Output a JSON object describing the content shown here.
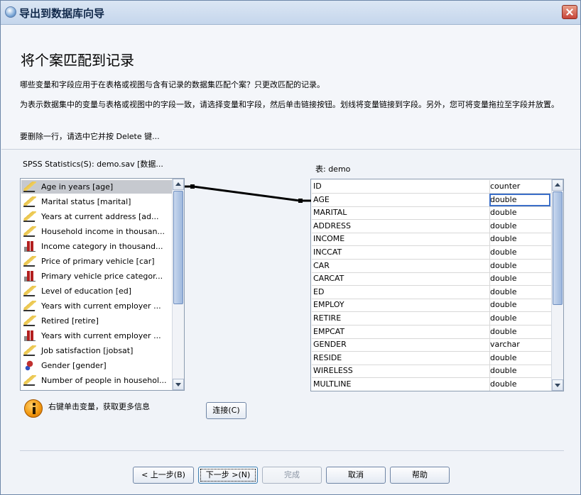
{
  "window": {
    "title": "导出到数据库向导"
  },
  "page": {
    "heading": "将个案匹配到记录",
    "line1": "哪些变量和字段应用于在表格或视图与含有记录的数据集匹配个案？只更改匹配的记录。",
    "line2": "为表示数据集中的变量与表格或视图中的字段一致，请选择变量和字段，然后单击链接按钮。划线将变量链接到字段。另外，您可将变量拖拉至字段并放置。",
    "line3": "要删除一行，请选中它并按 Delete 键..."
  },
  "source": {
    "label_prefix": "SPSS Statistics(S)",
    "label_rest": ":  demo.sav [数据...",
    "variables": [
      {
        "label": "Age in years [age]",
        "icon": "scale-ruler-icon",
        "selected": true
      },
      {
        "label": "Marital status [marital]",
        "icon": "scale-ruler-icon"
      },
      {
        "label": "Years at current address [ad...",
        "icon": "scale-ruler-icon"
      },
      {
        "label": "Household income in thousan...",
        "icon": "scale-ruler-icon"
      },
      {
        "label": "Income category in thousand...",
        "icon": "ordinal-bars-icon"
      },
      {
        "label": "Price of primary vehicle [car]",
        "icon": "scale-ruler-icon"
      },
      {
        "label": "Primary vehicle price categor...",
        "icon": "ordinal-bars-icon"
      },
      {
        "label": "Level of education [ed]",
        "icon": "scale-ruler-icon"
      },
      {
        "label": "Years with current employer ...",
        "icon": "scale-ruler-icon"
      },
      {
        "label": "Retired [retire]",
        "icon": "scale-ruler-icon"
      },
      {
        "label": "Years with current employer ...",
        "icon": "ordinal-bars-icon"
      },
      {
        "label": "Job satisfaction [jobsat]",
        "icon": "scale-ruler-icon"
      },
      {
        "label": "Gender [gender]",
        "icon": "nominal-icon"
      },
      {
        "label": "Number of people in househol...",
        "icon": "scale-ruler-icon"
      }
    ]
  },
  "table": {
    "label": "表:   demo",
    "rows": [
      {
        "field": "ID",
        "type": "counter"
      },
      {
        "field": "AGE",
        "type": "double",
        "selected": true
      },
      {
        "field": "MARITAL",
        "type": "double"
      },
      {
        "field": "ADDRESS",
        "type": "double"
      },
      {
        "field": "INCOME",
        "type": "double"
      },
      {
        "field": "INCCAT",
        "type": "double"
      },
      {
        "field": "CAR",
        "type": "double"
      },
      {
        "field": "CARCAT",
        "type": "double"
      },
      {
        "field": "ED",
        "type": "double"
      },
      {
        "field": "EMPLOY",
        "type": "double"
      },
      {
        "field": "RETIRE",
        "type": "double"
      },
      {
        "field": "EMPCAT",
        "type": "double"
      },
      {
        "field": "GENDER",
        "type": "varchar"
      },
      {
        "field": "RESIDE",
        "type": "double"
      },
      {
        "field": "WIRELESS",
        "type": "double"
      },
      {
        "field": "MULTLINE",
        "type": "double"
      }
    ]
  },
  "info": {
    "text": "右键单击变量，获取更多信息"
  },
  "buttons": {
    "connect": "连接(C)",
    "back": "< 上一步(B)",
    "next": "下一步 >(N)",
    "finish": "完成",
    "cancel": "取消",
    "help": "帮助"
  },
  "colors": {
    "accent": "#3a6ec8",
    "titlebar": "#c5d6ec",
    "close": "#c8453a"
  }
}
